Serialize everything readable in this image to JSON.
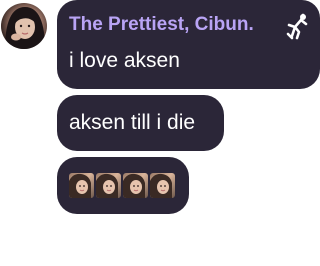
{
  "avatar": {
    "icon": "user-avatar-icon"
  },
  "messages": [
    {
      "sender": "The Prettiest, Cibun.",
      "badge_icon": "dancing-figure-icon",
      "text": "i love aksen"
    },
    {
      "text": "aksen till i die"
    },
    {
      "stickers": [
        "face-sticker-icon",
        "face-sticker-icon",
        "face-sticker-icon",
        "face-sticker-icon"
      ]
    }
  ],
  "colors": {
    "bubble": "#2b2638",
    "sender_name": "#b9a4f5",
    "text": "#ffffff"
  }
}
